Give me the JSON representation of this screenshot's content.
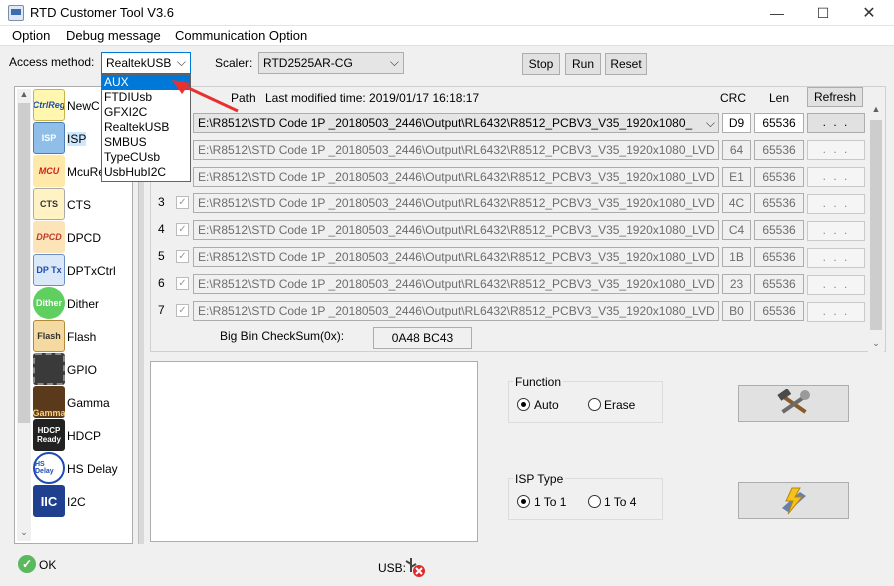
{
  "window": {
    "title": "RTD Customer Tool V3.6",
    "min_glyph": "—",
    "max_glyph": "☐",
    "close_glyph": "✕"
  },
  "menu": [
    "Option",
    "Debug message",
    "Communication Option"
  ],
  "access": {
    "label": "Access method:",
    "selected": "RealtekUSB",
    "options": [
      "AUX",
      "FTDIUsb",
      "GFXI2C",
      "RealtekUSB",
      "SMBUS",
      "TypeCUsb",
      "UsbHubI2C"
    ],
    "highlighted": "AUX"
  },
  "scaler": {
    "label": "Scaler:",
    "selected": "RTD2525AR-CG"
  },
  "toolbar": {
    "stop": "Stop",
    "run": "Run",
    "reset": "Reset"
  },
  "nav": [
    {
      "label": "NewC",
      "icon": "ctrlreg-icon",
      "icon_text": "CtrlReg"
    },
    {
      "label": "ISP",
      "icon": "isp-icon",
      "icon_text": "ISP"
    },
    {
      "label": "McuRe",
      "icon": "mcu-icon",
      "icon_text": "MCU"
    },
    {
      "label": "CTS",
      "icon": "cts-icon",
      "icon_text": "CTS"
    },
    {
      "label": "DPCD",
      "icon": "dpcd-icon",
      "icon_text": "DPCD"
    },
    {
      "label": "DPTxCtrl",
      "icon": "dptx-icon",
      "icon_text": "DP Tx"
    },
    {
      "label": "Dither",
      "icon": "dither-icon",
      "icon_text": "Dither"
    },
    {
      "label": "Flash",
      "icon": "flash-icon",
      "icon_text": "Flash"
    },
    {
      "label": "GPIO",
      "icon": "gpio-icon",
      "icon_text": ""
    },
    {
      "label": "Gamma",
      "icon": "gamma-icon",
      "icon_text": "Gamma"
    },
    {
      "label": "HDCP",
      "icon": "hdcp-icon",
      "icon_text": "HDCP Ready"
    },
    {
      "label": "HS Delay",
      "icon": "hsdelay-icon",
      "icon_text": "HS Delay"
    },
    {
      "label": "I2C",
      "icon": "i2c-icon",
      "icon_text": "IIC"
    }
  ],
  "grid": {
    "path_header": "Path",
    "last_modified": "Last modified time: 2019/01/17 16:18:17",
    "crc_header": "CRC",
    "len_header": "Len",
    "refresh": "Refresh",
    "rows": [
      {
        "num": "",
        "path": "E:\\R8512\\STD Code 1P _20180503_2446\\Output\\RL6432\\R8512_PCBV3_V35_1920x1080_",
        "crc": "D9",
        "len": "65536",
        "btn": ". . ."
      },
      {
        "num": "",
        "path": "E:\\R8512\\STD Code 1P _20180503_2446\\Output\\RL6432\\R8512_PCBV3_V35_1920x1080_LVD",
        "crc": "64",
        "len": "65536",
        "btn": ". . ."
      },
      {
        "num": "",
        "path": "E:\\R8512\\STD Code 1P _20180503_2446\\Output\\RL6432\\R8512_PCBV3_V35_1920x1080_LVD",
        "crc": "E1",
        "len": "65536",
        "btn": ". . ."
      },
      {
        "num": "3",
        "path": "E:\\R8512\\STD Code 1P _20180503_2446\\Output\\RL6432\\R8512_PCBV3_V35_1920x1080_LVD",
        "crc": "4C",
        "len": "65536",
        "btn": ". . ."
      },
      {
        "num": "4",
        "path": "E:\\R8512\\STD Code 1P _20180503_2446\\Output\\RL6432\\R8512_PCBV3_V35_1920x1080_LVD",
        "crc": "C4",
        "len": "65536",
        "btn": ". . ."
      },
      {
        "num": "5",
        "path": "E:\\R8512\\STD Code 1P _20180503_2446\\Output\\RL6432\\R8512_PCBV3_V35_1920x1080_LVD",
        "crc": "1B",
        "len": "65536",
        "btn": ". . ."
      },
      {
        "num": "6",
        "path": "E:\\R8512\\STD Code 1P _20180503_2446\\Output\\RL6432\\R8512_PCBV3_V35_1920x1080_LVD",
        "crc": "23",
        "len": "65536",
        "btn": ". . ."
      },
      {
        "num": "7",
        "path": "E:\\R8512\\STD Code 1P _20180503_2446\\Output\\RL6432\\R8512_PCBV3_V35_1920x1080_LVD",
        "crc": "B0",
        "len": "65536",
        "btn": ". . ."
      }
    ],
    "checksum_label": "Big Bin CheckSum(0x):",
    "checksum_value": "0A48 BC43"
  },
  "function": {
    "title": "Function",
    "auto": "Auto",
    "erase": "Erase",
    "selected": "Auto"
  },
  "isp_type": {
    "title": "ISP Type",
    "one_to_one": "1 To 1",
    "one_to_four": "1 To 4",
    "selected": "1 To 1"
  },
  "status": {
    "ok": "OK",
    "usb": "USB:"
  },
  "colors": {
    "accent": "#0078d7",
    "arrow": "#e8312f"
  }
}
